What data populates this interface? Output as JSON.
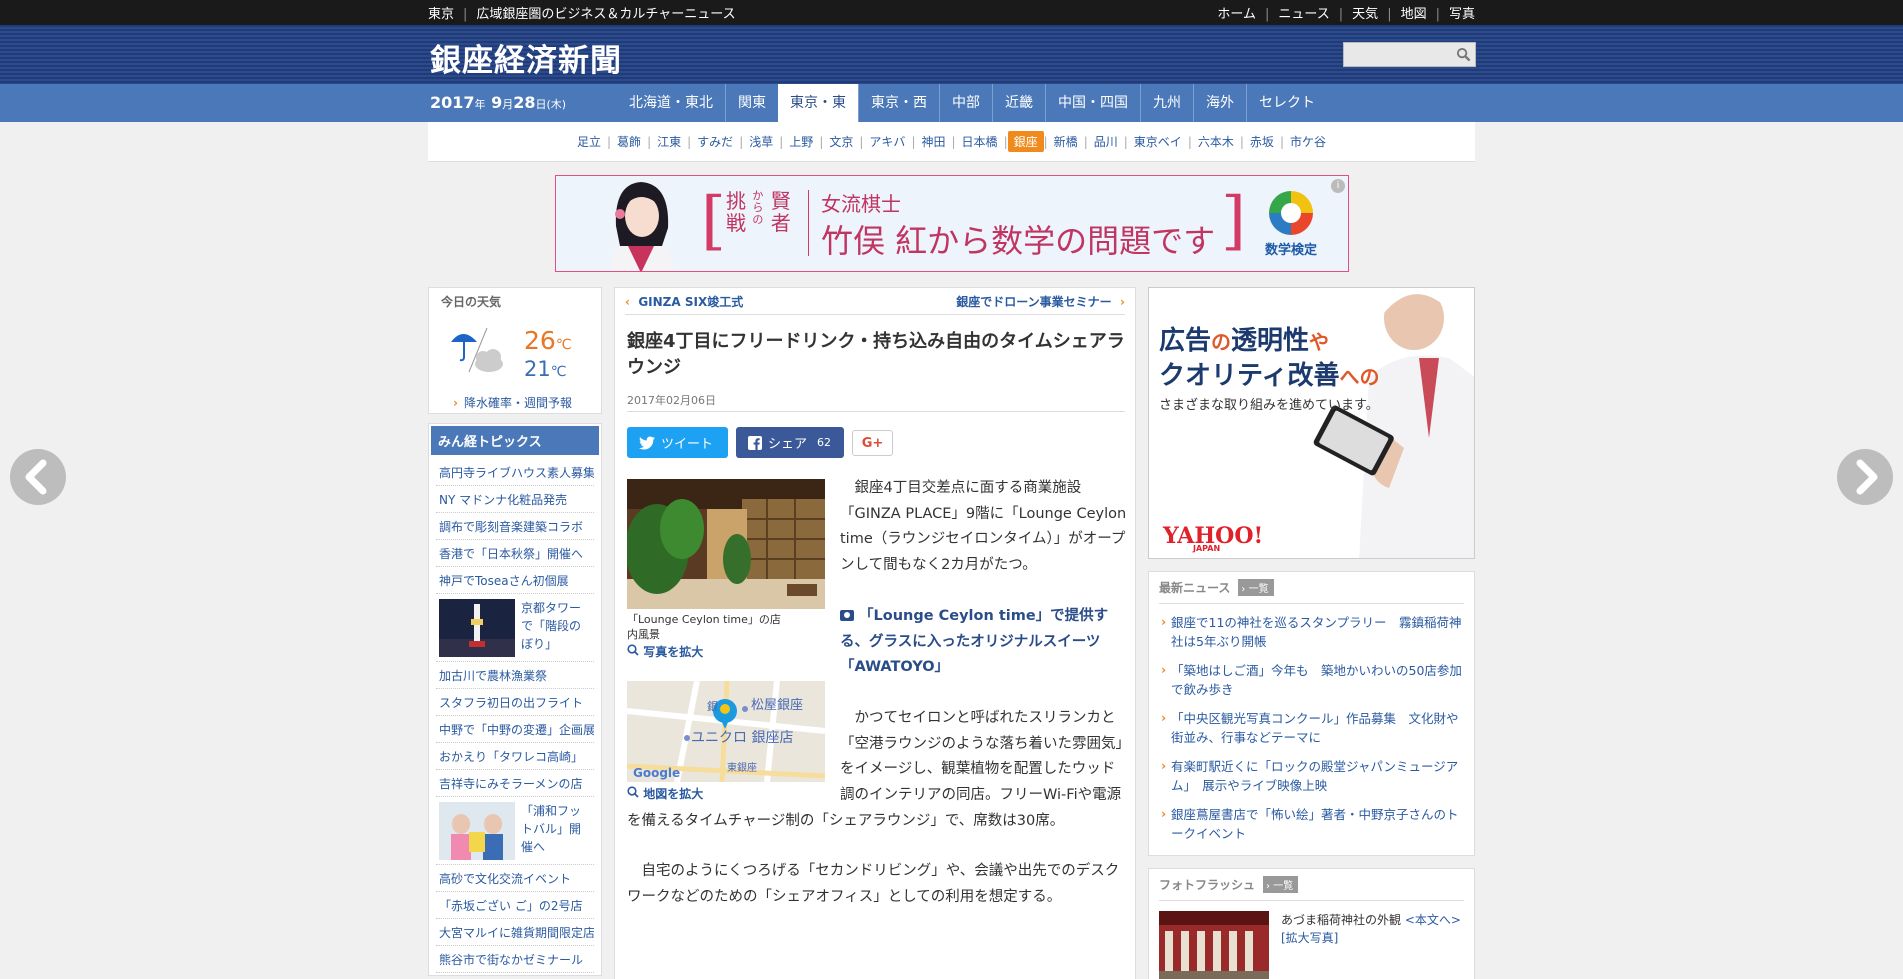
{
  "topbar": {
    "site_label": "東京",
    "tagline": "広域銀座圏のビジネス＆カルチャーニュース",
    "nav": [
      "ホーム",
      "ニュース",
      "天気",
      "地図",
      "写真"
    ]
  },
  "header": {
    "logo": "銀座経済新聞",
    "search_placeholder": ""
  },
  "datebar": {
    "year": "2017",
    "year_unit": "年",
    "month": "9",
    "month_unit": "月",
    "day": "28",
    "day_unit": "日",
    "weekday": "(木)"
  },
  "regions": {
    "items": [
      "北海道・東北",
      "関東",
      "東京・東",
      "東京・西",
      "中部",
      "近畿",
      "中国・四国",
      "九州",
      "海外",
      "セレクト"
    ],
    "active_index": 2
  },
  "cities": {
    "items": [
      "足立",
      "葛飾",
      "江東",
      "すみだ",
      "浅草",
      "上野",
      "文京",
      "アキバ",
      "神田",
      "日本橋",
      "銀座",
      "新橋",
      "品川",
      "東京ベイ",
      "六本木",
      "赤坂",
      "市ケ谷"
    ],
    "active_index": 10
  },
  "banner": {
    "kenja": "賢者",
    "kara": "からの",
    "chousen": "挑戦",
    "line1": "女流棋士",
    "line2": "竹俣 紅から数学の問題です",
    "brand": "数学検定",
    "info": "i"
  },
  "weather": {
    "title": "今日の天気",
    "high": "26",
    "low": "21",
    "unit": "℃",
    "link": "降水確率・週間予報"
  },
  "topics": {
    "title": "みん経トピックス",
    "items": [
      "高円寺ライブハウス素人募集",
      "NY マドンナ化粧品発売",
      "調布で彫刻音楽建築コラボ",
      "香港で「日本秋祭」開催へ",
      "神戸でToseaさん初個展",
      "京都タワーで「階段のぼり」",
      "加古川で農林漁業祭",
      "スタフラ初日の出フライト",
      "中野で「中野の変遷」企画展",
      "おかえり「タワレコ高崎」",
      "吉祥寺にみそラーメンの店",
      "「浦和フットバル」開催へ",
      "高砂で文化交流イベント",
      "「赤坂ござい ご」の2号店",
      "大宮マルイに雑貨期間限定店",
      "熊谷市で街なかゼミナール"
    ]
  },
  "article": {
    "prev": "GINZA SIX竣工式",
    "next": "銀座でドローン事業セミナー",
    "title": "銀座4丁目にフリードリンク・持ち込み自由のタイムシェアラウンジ",
    "date": "2017年02月06日",
    "tweet": "ツイート",
    "share": "シェア",
    "share_count": "62",
    "gplus": "G+",
    "photo_caption": "「Lounge Ceylon time」の店内風景",
    "photo_zoom": "写真を拡大",
    "map_zoom": "地図を拡大",
    "map_labels": {
      "store1": "松屋銀座",
      "store2": "ユニクロ 銀座店",
      "station": "東銀座",
      "ginza": "銀",
      "google": "Google"
    },
    "para1": "銀座4丁目交差点に面する商業施設「GINZA PLACE」9階に「Lounge Ceylon time（ラウンジセイロンタイム）」がオープンして間もなく2カ月がたつ。",
    "highlight": "「Lounge Ceylon time」で提供する、グラスに入ったオリジナルスイーツ「AWATOYO」",
    "para2": "かつてセイロンと呼ばれたスリランカと「空港ラウンジのような落ち着いた雰囲気」をイメージし、観葉植物を配置したウッド調のインテリアの同店。フリーWi-Fiや電源を備えるタイムチャージ制の「シェアラウンジ」で、席数は30席。",
    "para3": "自宅のようにくつろげる「セカンドリビング」や、会議や出先でのデスクワークなどのための「シェアオフィス」としての利用を想定する。"
  },
  "ad_right": {
    "line1a": "広告",
    "line1b": "の",
    "line1c": "透明性",
    "line1d": "や",
    "line2a": "クオリティ改善",
    "line2b": "への",
    "line3": "さまざまな取り組みを進めています。",
    "brand": "YAHOO!",
    "brand_sub": "JAPAN"
  },
  "latest_news": {
    "title": "最新ニュース",
    "more": "一覧",
    "items": [
      "銀座で11の神社を巡るスタンプラリー　霧鎮稲荷神社は5年ぶり開帳",
      "「築地はしご酒」今年も　築地かいわいの50店参加で飲み歩き",
      "「中央区観光写真コンクール」作品募集　文化財や街並み、行事などテーマに",
      "有楽町駅近くに「ロックの殿堂ジャパンミュージアム」　展示やライブ映像上映",
      "銀座蔦屋書店で「怖い絵」著者・中野京子さんのトークイベント"
    ]
  },
  "photoflash": {
    "title": "フォトフラッシュ",
    "more": "一覧",
    "caption": "あづま稲荷神社の外観",
    "link1": "<本文へ>",
    "link2": "[拡大写真]"
  },
  "colors": {
    "header_blue": "#1f3b78",
    "nav_blue": "#4a78b8",
    "accent_orange": "#f08a1d",
    "link_blue": "#2a5aa0"
  }
}
